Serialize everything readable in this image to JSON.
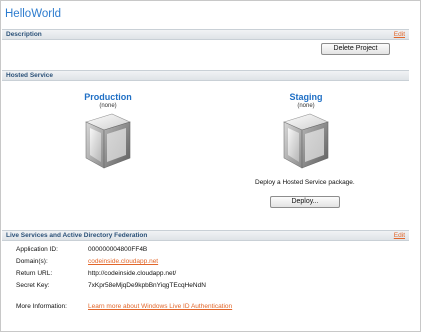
{
  "app": {
    "title": "HelloWorld"
  },
  "description_section": {
    "label": "Description",
    "edit_label": "Edit",
    "delete_button": "Delete Project"
  },
  "hosted_service_section": {
    "label": "Hosted Service",
    "production": {
      "title": "Production",
      "status": "(none)"
    },
    "staging": {
      "title": "Staging",
      "status": "(none)",
      "message": "Deploy a Hosted Service package.",
      "deploy_button": "Deploy..."
    }
  },
  "live_services_section": {
    "label": "Live Services and Active Directory Federation",
    "edit_label": "Edit",
    "rows": [
      {
        "label": "Application ID:",
        "value": "000000004800FF4B",
        "is_link": false
      },
      {
        "label": "Domain(s):",
        "value": "codeinside.cloudapp.net",
        "is_link": true
      },
      {
        "label": "Return URL:",
        "value": "http://codeinside.cloudapp.net/",
        "is_link": false
      },
      {
        "label": "Secret Key:",
        "value": "7xKpr58eMjqDe9kpbBnYiqgTEcqHeNdN",
        "is_link": false
      }
    ],
    "more_info_label": "More Information:",
    "more_info_link": "Learn more about Windows Live ID Authentication"
  },
  "colors": {
    "title_blue": "#2d7ccf",
    "section_text": "#2b5178",
    "link_orange": "#e2662a",
    "env_title_blue": "#1f6fc5"
  },
  "icons": {
    "production_cube": "empty-deployment-cube-icon",
    "staging_cube": "empty-deployment-cube-icon"
  }
}
